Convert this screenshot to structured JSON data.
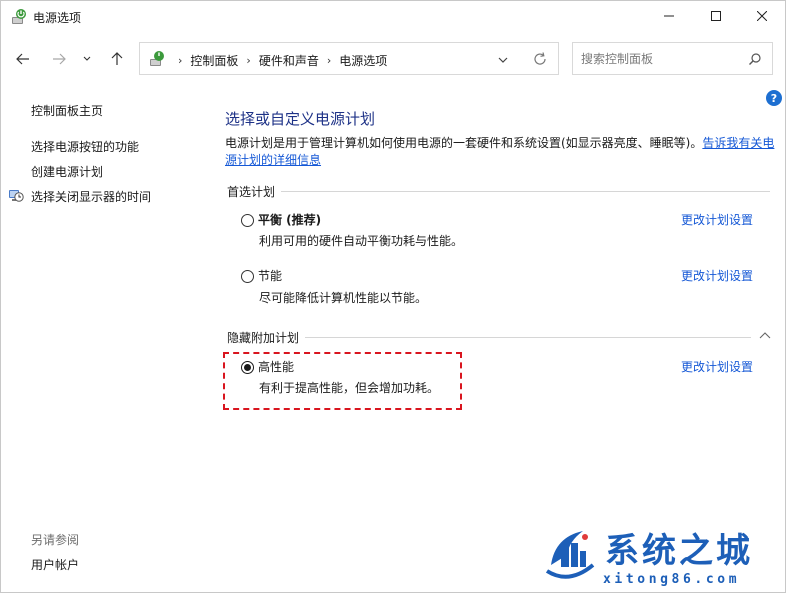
{
  "window": {
    "title": "电源选项"
  },
  "nav": {
    "breadcrumbs": [
      "控制面板",
      "硬件和声音",
      "电源选项"
    ]
  },
  "search": {
    "placeholder": "搜索控制面板"
  },
  "help": {
    "label": "?"
  },
  "sidebar": {
    "home": "控制面板主页",
    "links": [
      "选择电源按钮的功能",
      "创建电源计划",
      "选择关闭显示器的时间"
    ],
    "see_also": "另请参阅",
    "user_accounts": "用户帐户"
  },
  "main": {
    "title": "选择或自定义电源计划",
    "description": "电源计划是用于管理计算机如何使用电源的一套硬件和系统设置(如显示器亮度、睡眠等)。",
    "description_link": "告诉我有关电源计划的详细信息",
    "preferred_group": "首选计划",
    "hidden_group": "隐藏附加计划",
    "change_label": "更改计划设置",
    "plans": [
      {
        "name": "平衡 (推荐)",
        "desc": "利用可用的硬件自动平衡功耗与性能。",
        "selected": false
      },
      {
        "name": "节能",
        "desc": "尽可能降低计算机性能以节能。",
        "selected": false
      },
      {
        "name": "高性能",
        "desc": "有利于提高性能，但会增加功耗。",
        "selected": true
      }
    ]
  },
  "watermark": {
    "title": "系统之城",
    "url": "xitong86.com"
  },
  "colors": {
    "link": "#1558d6",
    "title": "#1e3287",
    "highlight": "#d9151f",
    "watermark": "#1d5fb8"
  }
}
